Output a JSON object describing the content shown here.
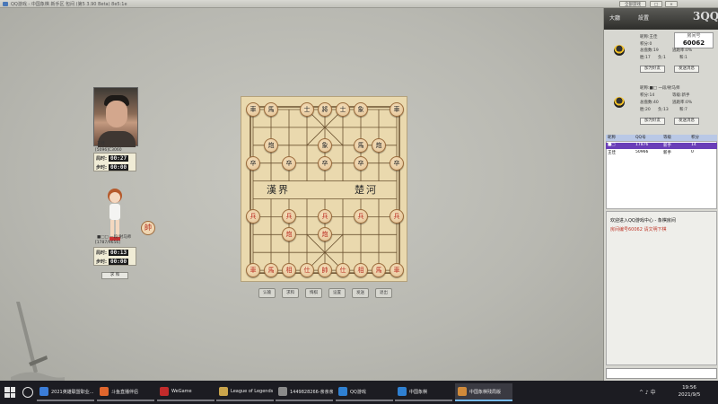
{
  "window": {
    "title": "QQ游戏 - 中国象棋 新手区 包间 (第5 3.90 Beta) 8e5:1e",
    "buttons": [
      "全部游戏",
      "□",
      "×"
    ]
  },
  "players": {
    "top": {
      "name": "王佳",
      "id": "[5096]C3060",
      "timer_labels": [
        "局时:",
        "步时:"
      ],
      "game_time": "00:27",
      "step_time": "00:00"
    },
    "bottom": {
      "name": "■□□ 一段/射马师",
      "id": "[1787/9656]",
      "timer_labels": [
        "局时:",
        "步时:"
      ],
      "game_time": "00:13",
      "step_time": "00:00",
      "badge": "帥",
      "button_label": "求 和"
    }
  },
  "board": {
    "river_left": "漢界",
    "river_right": "楚河",
    "pieces": [
      {
        "c": "black",
        "t": "車",
        "f": 0,
        "r": 0
      },
      {
        "c": "black",
        "t": "馬",
        "f": 1,
        "r": 0
      },
      {
        "c": "black",
        "t": "士",
        "f": 3,
        "r": 0
      },
      {
        "c": "black",
        "t": "將",
        "f": 4,
        "r": 0
      },
      {
        "c": "black",
        "t": "士",
        "f": 5,
        "r": 0
      },
      {
        "c": "black",
        "t": "象",
        "f": 6,
        "r": 0
      },
      {
        "c": "black",
        "t": "車",
        "f": 8,
        "r": 0
      },
      {
        "c": "black",
        "t": "象",
        "f": 4,
        "r": 2
      },
      {
        "c": "black",
        "t": "炮",
        "f": 1,
        "r": 2
      },
      {
        "c": "black",
        "t": "馬",
        "f": 6,
        "r": 2
      },
      {
        "c": "black",
        "t": "炮",
        "f": 7,
        "r": 2
      },
      {
        "c": "black",
        "t": "卒",
        "f": 0,
        "r": 3
      },
      {
        "c": "black",
        "t": "卒",
        "f": 2,
        "r": 3
      },
      {
        "c": "black",
        "t": "卒",
        "f": 4,
        "r": 3
      },
      {
        "c": "black",
        "t": "卒",
        "f": 6,
        "r": 3
      },
      {
        "c": "black",
        "t": "卒",
        "f": 8,
        "r": 3
      },
      {
        "c": "red",
        "t": "兵",
        "f": 0,
        "r": 6
      },
      {
        "c": "red",
        "t": "兵",
        "f": 2,
        "r": 6
      },
      {
        "c": "red",
        "t": "兵",
        "f": 4,
        "r": 6
      },
      {
        "c": "red",
        "t": "兵",
        "f": 6,
        "r": 6
      },
      {
        "c": "red",
        "t": "兵",
        "f": 8,
        "r": 6
      },
      {
        "c": "red",
        "t": "炮",
        "f": 2,
        "r": 7
      },
      {
        "c": "red",
        "t": "炮",
        "f": 4,
        "r": 7
      },
      {
        "c": "red",
        "t": "車",
        "f": 0,
        "r": 9
      },
      {
        "c": "red",
        "t": "馬",
        "f": 1,
        "r": 9
      },
      {
        "c": "red",
        "t": "相",
        "f": 2,
        "r": 9
      },
      {
        "c": "red",
        "t": "仕",
        "f": 3,
        "r": 9
      },
      {
        "c": "red",
        "t": "帥",
        "f": 4,
        "r": 9
      },
      {
        "c": "red",
        "t": "仕",
        "f": 5,
        "r": 9
      },
      {
        "c": "red",
        "t": "相",
        "f": 6,
        "r": 9
      },
      {
        "c": "red",
        "t": "馬",
        "f": 7,
        "r": 9
      },
      {
        "c": "red",
        "t": "車",
        "f": 8,
        "r": 9
      }
    ]
  },
  "controls": [
    "认输",
    "求和",
    "悔棋",
    "设置",
    "发送",
    "退出"
  ],
  "panel": {
    "header_buttons": [
      "大廳",
      "設置"
    ],
    "logo": "3QQ",
    "room_label": "房间号",
    "room_number": "60062",
    "player1": {
      "fields": [
        [
          "昵称:",
          "王佳"
        ],
        [
          "积分:",
          "0"
        ],
        [
          "等级:",
          "新手"
        ],
        [
          "总盘数:",
          "19"
        ],
        [
          "逃跑率:",
          "0%"
        ],
        [
          "胜:",
          "17"
        ],
        [
          "负:",
          "1"
        ],
        [
          "和:",
          "1"
        ]
      ],
      "buttons": [
        "加为好友",
        "发送消息"
      ]
    },
    "player2": {
      "fields": [
        [
          "昵称:",
          "■□ 一段/射马师"
        ],
        [
          "积分:",
          "14"
        ],
        [
          "等级:",
          "新手"
        ],
        [
          "总盘数:",
          "40"
        ],
        [
          "逃跑率:",
          "0%"
        ],
        [
          "胜:",
          "20"
        ],
        [
          "负:",
          "13"
        ],
        [
          "和:",
          "7"
        ]
      ],
      "buttons": [
        "加为好友",
        "发送消息"
      ]
    },
    "list_headers": [
      "昵称",
      "QQ号",
      "等级",
      "积分"
    ],
    "list_rows": [
      [
        "■□",
        "17876",
        "新手",
        "14"
      ],
      [
        "王佳",
        "50966",
        "新手",
        "0"
      ]
    ],
    "chat_lines": [
      {
        "text": "欢迎进入QQ游戏中心 - 象棋房间",
        "color": "#111111"
      },
      {
        "text": "房间编号60062 请文明下棋",
        "color": "#c0392b"
      }
    ]
  },
  "taskbar": {
    "tasks": [
      {
        "label": "2021英雄联盟职业...",
        "color": "#3b7dd8"
      },
      {
        "label": "斗鱼直播伴侣",
        "color": "#e0662d"
      },
      {
        "label": "WeGame",
        "color": "#c22b2b"
      },
      {
        "label": "League of Legends",
        "color": "#c9a44b"
      },
      {
        "label": "1449828266-亲亲亲",
        "color": "#8a8a8a"
      },
      {
        "label": "QQ游戏",
        "color": "#2f80d1"
      },
      {
        "label": "中国象棋",
        "color": "#2f80d1"
      },
      {
        "label": "中国象棋残局版",
        "color": "#d08a3a"
      }
    ],
    "tray": "^ ♪ 中",
    "time": "19:56",
    "date": "2021/9/5"
  }
}
